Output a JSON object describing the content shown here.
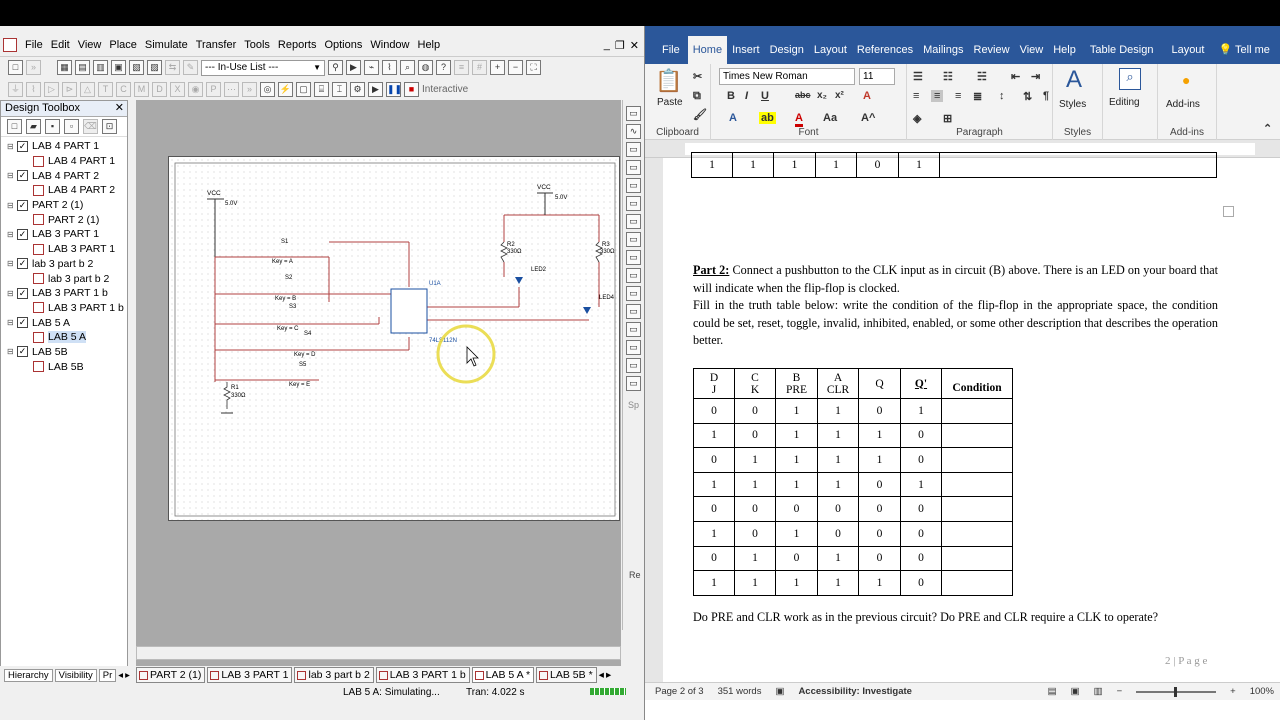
{
  "multisim": {
    "menu": [
      "File",
      "Edit",
      "View",
      "Place",
      "Simulate",
      "Transfer",
      "Tools",
      "Reports",
      "Options",
      "Window",
      "Help"
    ],
    "in_use_list": "--- In-Use List ---",
    "interactive_label": "Interactive",
    "toolbox_title": "Design Toolbox",
    "tree": [
      {
        "label": "LAB 4 PART 1",
        "level": 0
      },
      {
        "label": "LAB 4 PART 1",
        "level": 1
      },
      {
        "label": "LAB 4 PART 2",
        "level": 0
      },
      {
        "label": "LAB 4 PART 2",
        "level": 1
      },
      {
        "label": "PART 2 (1)",
        "level": 0
      },
      {
        "label": "PART 2 (1)",
        "level": 1
      },
      {
        "label": "LAB 3 PART 1",
        "level": 0
      },
      {
        "label": "LAB 3 PART 1",
        "level": 1
      },
      {
        "label": "lab 3 part b 2",
        "level": 0
      },
      {
        "label": "lab 3 part b 2",
        "level": 1
      },
      {
        "label": "LAB 3 PART 1 b",
        "level": 0
      },
      {
        "label": "LAB 3 PART 1 b",
        "level": 1
      },
      {
        "label": "LAB 5 A",
        "level": 0
      },
      {
        "label": "LAB 5 A",
        "level": 1,
        "selected": true
      },
      {
        "label": "LAB 5B",
        "level": 0
      },
      {
        "label": "LAB 5B",
        "level": 1
      }
    ],
    "toolbox_tabs": [
      "Hierarchy",
      "Visibility",
      "Pr"
    ],
    "doc_tabs": [
      "PART 2 (1)",
      "LAB 3 PART 1",
      "lab 3 part b 2",
      "LAB 3 PART 1 b",
      "LAB 5 A *",
      "LAB 5B *"
    ],
    "status": {
      "sim": "LAB 5 A: Simulating...",
      "tran": "Tran: 4.022 s"
    },
    "schematic": {
      "vcc1": "VCC",
      "vcc1_v": "5.0V",
      "vcc2": "VCC",
      "vcc2_v": "5.0V",
      "s1": "S1",
      "s1_key": "Key = A",
      "s2": "S2",
      "s2_key": "Key = B",
      "s3": "S3",
      "s3_key": "Key = C",
      "s4": "S4",
      "s4_key": "Key = D",
      "s5": "S5",
      "s5_key": "Key = E",
      "u1": "U1A",
      "u1_part": "74LS112N",
      "r1": "R1",
      "r1_v": "330Ω",
      "r2": "R2",
      "r2_v": "330Ω",
      "r3": "R3",
      "r3_v": "330Ω",
      "led2": "LED2",
      "led4": "LED4"
    },
    "side_labels": [
      "Sp",
      "Re"
    ]
  },
  "word": {
    "tabs": [
      "File",
      "Home",
      "Insert",
      "Design",
      "Layout",
      "References",
      "Mailings",
      "Review",
      "View",
      "Help",
      "Table Design",
      "Layout"
    ],
    "tell_me": "Tell me",
    "font_name": "Times New Roman",
    "font_size": "11",
    "paste": "Paste",
    "styles": "Styles",
    "editing": "Editing",
    "addins": "Add-ins",
    "groups": [
      "Clipboard",
      "Font",
      "Paragraph",
      "Styles",
      "Add-ins"
    ],
    "prev_row": [
      "1",
      "1",
      "1",
      "1",
      "0",
      "1"
    ],
    "part2_heading": "Part 2:",
    "part2_text1": " Connect a pushbutton to the CLK input as in circuit (B) above. There is an LED on your board that will indicate when the flip-flop is clocked.",
    "part2_text2": "Fill in the truth table below: write the condition of the flip-flop in the appropriate space, the condition could be set, reset, toggle, invalid, inhibited, enabled, or some other description that describes the operation better.",
    "table_headers": [
      [
        "D",
        "J"
      ],
      [
        "C",
        "K"
      ],
      [
        "B",
        "PRE"
      ],
      [
        "A",
        "CLR"
      ],
      [
        "Q"
      ],
      [
        "Q'"
      ],
      [
        "Condition"
      ]
    ],
    "table_rows": [
      [
        "0",
        "0",
        "1",
        "1",
        "0",
        "1",
        ""
      ],
      [
        "1",
        "0",
        "1",
        "1",
        "1",
        "0",
        ""
      ],
      [
        "0",
        "1",
        "1",
        "1",
        "1",
        "0",
        ""
      ],
      [
        "1",
        "1",
        "1",
        "1",
        "0",
        "1",
        ""
      ],
      [
        "0",
        "0",
        "0",
        "0",
        "0",
        "0",
        ""
      ],
      [
        "1",
        "0",
        "1",
        "0",
        "0",
        "0",
        ""
      ],
      [
        "0",
        "1",
        "0",
        "1",
        "0",
        "0",
        ""
      ],
      [
        "1",
        "1",
        "1",
        "1",
        "1",
        "0",
        ""
      ]
    ],
    "question": "Do PRE and CLR work as in the previous circuit? Do PRE and CLR require a CLK to operate?",
    "page_footer": "2 | P a g e",
    "status": {
      "page": "Page 2 of 3",
      "words": "351 words",
      "accessibility": "Accessibility: Investigate",
      "zoom": "100%"
    }
  }
}
